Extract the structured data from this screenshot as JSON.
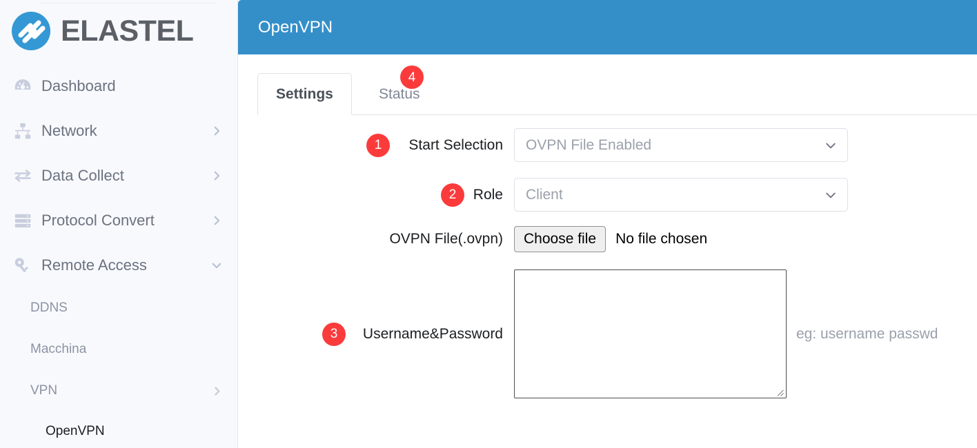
{
  "brand": {
    "name": "ELASTEL",
    "logo_icon": "elastel-logo-icon"
  },
  "sidebar": {
    "items": [
      {
        "label": "Dashboard",
        "icon": "dashboard-gauge-icon",
        "chevron": "none"
      },
      {
        "label": "Network",
        "icon": "network-tree-icon",
        "chevron": "right"
      },
      {
        "label": "Data Collect",
        "icon": "data-exchange-icon",
        "chevron": "right"
      },
      {
        "label": "Protocol Convert",
        "icon": "server-stack-icon",
        "chevron": "right"
      },
      {
        "label": "Remote Access",
        "icon": "key-icon",
        "chevron": "down"
      }
    ],
    "sub_items": [
      {
        "label": "DDNS",
        "chevron": "none"
      },
      {
        "label": "Macchina",
        "chevron": "none"
      },
      {
        "label": "VPN",
        "chevron": "right"
      }
    ],
    "level2_items": [
      {
        "label": "OpenVPN",
        "active": true
      }
    ]
  },
  "header": {
    "title": "OpenVPN",
    "bg_color": "#348fc9"
  },
  "tabs": {
    "items": [
      {
        "label": "Settings",
        "active": true
      },
      {
        "label": "Status",
        "active": false,
        "badge": "4"
      }
    ]
  },
  "badges": {
    "color": "#fb3b3b"
  },
  "form": {
    "start_selection": {
      "badge": "1",
      "label": "Start Selection",
      "value": "OVPN File Enabled",
      "chevron_icon": "chevron-down-icon"
    },
    "role": {
      "badge": "2",
      "label": "Role",
      "value": "Client",
      "chevron_icon": "chevron-down-icon"
    },
    "ovpn_file": {
      "label": "OVPN File(.ovpn)",
      "button_label": "Choose file",
      "status_text": "No file chosen"
    },
    "credentials": {
      "badge": "3",
      "label": "Username&Password",
      "value": "",
      "hint": "eg: username passwd"
    }
  }
}
